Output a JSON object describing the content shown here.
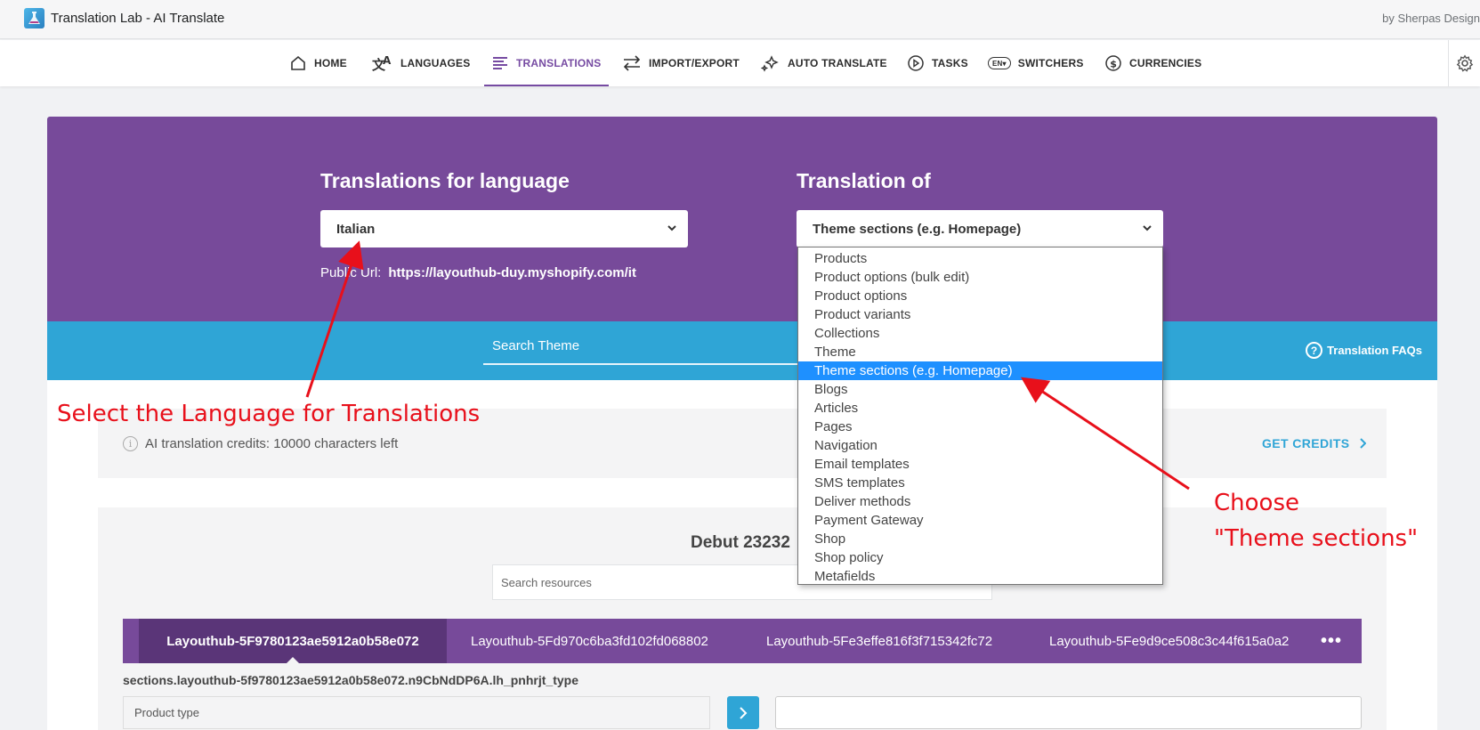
{
  "app": {
    "title": "Translation Lab - AI Translate",
    "byline": "by Sherpas Design"
  },
  "nav": {
    "items": [
      {
        "label": "HOME",
        "icon": "home-icon"
      },
      {
        "label": "LANGUAGES",
        "icon": "languages-icon"
      },
      {
        "label": "TRANSLATIONS",
        "icon": "translations-icon",
        "active": true
      },
      {
        "label": "IMPORT/EXPORT",
        "icon": "import-export-icon"
      },
      {
        "label": "AUTO TRANSLATE",
        "icon": "sparkles-icon"
      },
      {
        "label": "TASKS",
        "icon": "play-circle-icon"
      },
      {
        "label": "SWITCHERS",
        "icon": "language-switcher-icon"
      },
      {
        "label": "CURRENCIES",
        "icon": "currency-icon"
      }
    ],
    "switcher_badge": "EN"
  },
  "hero": {
    "language_heading": "Translations for language",
    "language_value": "Italian",
    "translation_of_heading": "Translation of",
    "translation_of_value": "Theme sections (e.g. Homepage)",
    "public_url_label": "Public Url:",
    "public_url_value": "https://layouthub-duy.myshopify.com/it"
  },
  "search": {
    "theme_placeholder": "Search Theme",
    "faq_label": "Translation FAQs"
  },
  "credits": {
    "text": "AI translation credits: 10000 characters left",
    "button": "GET CREDITS"
  },
  "theme": {
    "name": "Debut 23232",
    "search_placeholder": "Search resources",
    "tabs": [
      "Layouthub-5F9780123ae5912a0b58e072",
      "Layouthub-5Fd970c6ba3fd102fd068802",
      "Layouthub-5Fe3effe816f3f715342fc72",
      "Layouthub-5Fe9d9ce508c3c44f615a0a2"
    ],
    "more": "•••",
    "field_key": "sections.layouthub-5f9780123ae5912a0b58e072.n9CbNdDP6A.lh_pnhrjt_type",
    "field_source": "Product type"
  },
  "dropdown": {
    "options": [
      "Products",
      "Product options (bulk edit)",
      "Product options",
      "Product variants",
      "Collections",
      "Theme",
      "Theme sections (e.g. Homepage)",
      "Blogs",
      "Articles",
      "Pages",
      "Navigation",
      "Email templates",
      "SMS templates",
      "Deliver methods",
      "Payment Gateway",
      "Shop",
      "Shop policy",
      "Metafields"
    ],
    "selected_index": 6
  },
  "annotations": {
    "language_note": "Select the Language for Translations",
    "sections_note_line1": "Choose",
    "sections_note_line2": "\"Theme sections\""
  },
  "colors": {
    "purple": "#774a9a",
    "blue": "#2fa5d6",
    "annotation_red": "#e8101b",
    "selection": "#1e90ff"
  }
}
